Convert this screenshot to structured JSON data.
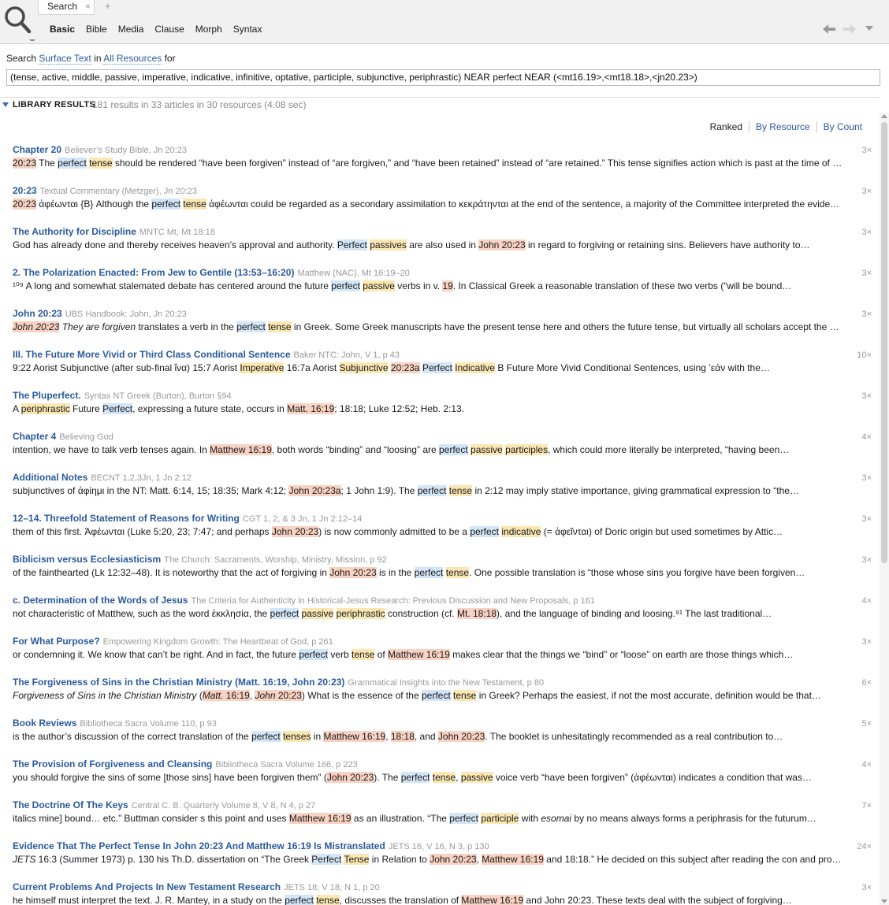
{
  "window": {
    "tab_label": "Search",
    "tab_close": "×",
    "tab_add": "+",
    "subtabs": [
      "Basic",
      "Bible",
      "Media",
      "Clause",
      "Morph",
      "Syntax"
    ],
    "active_subtab": "Basic"
  },
  "query": {
    "prefix": "Search",
    "field": "Surface Text",
    "in": "in",
    "scope": "All Resources",
    "for": "for",
    "text": "(tense, active, middle, passive, imperative, indicative, infinitive, optative, participle, subjunctive, periphrastic) NEAR perfect NEAR (<mt16.19>,<mt18.18>,<jn20.23>)"
  },
  "library": {
    "title": "LIBRARY RESULTS",
    "summary": "181 results in 33 articles in 30 resources (4.08 sec)"
  },
  "sort": [
    "Ranked",
    "By Resource",
    "By Count"
  ],
  "colors": {
    "link": "#2a5a9c",
    "hl_term": "#d3e6f7",
    "hl_form": "#fbe7b3",
    "hl_ref": "#f8d2c2"
  },
  "results": [
    {
      "title": "Chapter 20",
      "source": "Believer’s Study Bible, Jn 20:23",
      "count": "3×",
      "snippet": [
        [
          "o",
          "20:23"
        ],
        [
          "n",
          " The "
        ],
        [
          "b",
          "perfect"
        ],
        [
          "n",
          " "
        ],
        [
          "y",
          "tense"
        ],
        [
          "n",
          " should be rendered “have been forgiven” instead of “are forgiven,” and “have been retained” instead of “are retained.” This tense signifies action which is past at the time of speaking"
        ]
      ]
    },
    {
      "title": "20:23",
      "source": "Textual Commentary (Metzger), Jn 20:23",
      "count": "3×",
      "snippet": [
        [
          "o",
          "20:23"
        ],
        [
          "n",
          "    ἀφέωνται {B} Although the "
        ],
        [
          "b",
          "perfect"
        ],
        [
          "n",
          " "
        ],
        [
          "y",
          "tense"
        ],
        [
          "n",
          " ἀφέωνται could be regarded as a secondary assimilation to κεκράτηνται at the end of the sentence, a majority of the Committee interpreted the evidence"
        ]
      ]
    },
    {
      "title": "The Authority for Discipline",
      "source": "MNTC Mt, Mt 18:18",
      "count": "3×",
      "snippet": [
        [
          "n",
          "God has already done and thereby receives heaven’s approval and authority. "
        ],
        [
          "b",
          "Perfect"
        ],
        [
          "n",
          " "
        ],
        [
          "y",
          "passives"
        ],
        [
          "n",
          " are also used in "
        ],
        [
          "o",
          "John 20:23"
        ],
        [
          "n",
          " in regard to forgiving or retaining sins. Believers have authority to…"
        ]
      ]
    },
    {
      "title": "2. The Polarization Enacted: From Jew to Gentile (13:53–16:20)",
      "source": "Matthew (NAC), Mt 16:19–20",
      "count": "3×",
      "snippet": [
        [
          "n",
          "¹⁰⁹ A long and somewhat stalemated debate has centered around the future "
        ],
        [
          "b",
          "perfect"
        ],
        [
          "n",
          " "
        ],
        [
          "y",
          "passive"
        ],
        [
          "n",
          " verbs in v. "
        ],
        [
          "o",
          "19"
        ],
        [
          "n",
          ". In Classical Greek a reasonable translation of these two verbs (“will be bound…"
        ]
      ]
    },
    {
      "title": "John 20:23",
      "source": "UBS Handbook: John, Jn 20:23",
      "count": "3×",
      "snippet": [
        [
          "oi",
          "John 20:23"
        ],
        [
          "i",
          " They are forgiven"
        ],
        [
          "n",
          " translates a verb in the "
        ],
        [
          "b",
          "perfect"
        ],
        [
          "n",
          " "
        ],
        [
          "y",
          "tense"
        ],
        [
          "n",
          " in Greek. Some Greek manuscripts have the present tense here and others the future tense, but virtually all scholars accept the perfect"
        ]
      ]
    },
    {
      "title": "III. The Future More Vivid or Third Class Conditional Sentence",
      "source": "Baker NTC: John, V 1, p 43",
      "count": "10×",
      "snippet": [
        [
          "n",
          "9:22 Aorist Subjunctive (after sub-final ἵνα) 15:7 Aorist "
        ],
        [
          "y",
          "Imperative"
        ],
        [
          "n",
          " 16:7a Aorist "
        ],
        [
          "y",
          "Subjunctive"
        ],
        [
          "n",
          " "
        ],
        [
          "o",
          "20:23a"
        ],
        [
          "n",
          " "
        ],
        [
          "b",
          "Perfect"
        ],
        [
          "n",
          " "
        ],
        [
          "y",
          "Indicative"
        ],
        [
          "n",
          " B Future More Vivid Conditional Sentences, using ’εάν with the…"
        ]
      ]
    },
    {
      "title": "The Pluperfect.",
      "source": "Syntax NT Greek (Burton), Burton §94",
      "count": "3×",
      "snippet": [
        [
          "n",
          "A "
        ],
        [
          "y",
          "periphrastic"
        ],
        [
          "n",
          " Future "
        ],
        [
          "b",
          "Perfect"
        ],
        [
          "n",
          ", expressing a future state, occurs in "
        ],
        [
          "o",
          "Matt. 16:19"
        ],
        [
          "n",
          "; 18:18; Luke 12:52; Heb. 2:13."
        ]
      ]
    },
    {
      "title": "Chapter 4",
      "source": "Believing God",
      "count": "4×",
      "snippet": [
        [
          "n",
          "intention, we have to talk verb tenses again. In "
        ],
        [
          "o",
          "Matthew 16:19"
        ],
        [
          "n",
          ", both words “binding” and “loosing” are "
        ],
        [
          "b",
          "perfect"
        ],
        [
          "n",
          " "
        ],
        [
          "y",
          "passive"
        ],
        [
          "n",
          " "
        ],
        [
          "y",
          "participles"
        ],
        [
          "n",
          ", which could more literally be interpreted, “having been…"
        ]
      ]
    },
    {
      "title": "Additional Notes",
      "source": "BECNT 1,2,3Jn, 1 Jn 2:12",
      "count": "3×",
      "snippet": [
        [
          "n",
          "subjunctives of ἀφίημι in the NT: Matt. 6:14, 15; 18:35; Mark 4:12; "
        ],
        [
          "o",
          "John 20:23a"
        ],
        [
          "n",
          "; 1 John 1:9). The "
        ],
        [
          "b",
          "perfect"
        ],
        [
          "n",
          " "
        ],
        [
          "y",
          "tense"
        ],
        [
          "n",
          " in 2:12 may imply stative importance, giving grammatical expression to “the…"
        ]
      ]
    },
    {
      "title": "12–14. Threefold Statement of Reasons for Writing",
      "source": "CGT 1, 2, & 3 Jn, 1 Jn 2:12–14",
      "count": "3×",
      "snippet": [
        [
          "n",
          "them of this first. Ἀφέωνται (Luke 5:20, 23; 7:47; and perhaps "
        ],
        [
          "o",
          "John 20:23"
        ],
        [
          "n",
          ") is now commonly admitted to be a "
        ],
        [
          "b",
          "perfect"
        ],
        [
          "n",
          " "
        ],
        [
          "y",
          "indicative"
        ],
        [
          "n",
          " (= ἀφεῖνται) of Doric origin but used sometimes by Attic…"
        ]
      ]
    },
    {
      "title": "Biblicism versus Ecclesiasticism",
      "source": "The Church: Sacraments, Worship, Ministry, Mission, p 92",
      "count": "3×",
      "snippet": [
        [
          "n",
          "of the fainthearted (Lk 12:32–48). It is noteworthy that the act of forgiving in "
        ],
        [
          "o",
          "John 20:23"
        ],
        [
          "n",
          " is in the "
        ],
        [
          "b",
          "perfect"
        ],
        [
          "n",
          " "
        ],
        [
          "y",
          "tense"
        ],
        [
          "n",
          ". One possible translation is “those whose sins you forgive have been forgiven…"
        ]
      ]
    },
    {
      "title": "c. Determination of the Words of Jesus",
      "source": "The Criteria for Authenticity in Historical-Jesus Research: Previous Discussion and New Proposals, p 161",
      "count": "4×",
      "snippet": [
        [
          "n",
          "not characteristic of Matthew, such as the word ἐκκλησία, the "
        ],
        [
          "b",
          "perfect"
        ],
        [
          "n",
          " "
        ],
        [
          "y",
          "passive"
        ],
        [
          "n",
          " "
        ],
        [
          "y",
          "periphrastic"
        ],
        [
          "n",
          " construction (cf. "
        ],
        [
          "o",
          "Mt. 18:18"
        ],
        [
          "n",
          "), and the language of binding and loosing.⁹¹ The last traditional…"
        ]
      ]
    },
    {
      "title": "For What Purpose?",
      "source": "Empowering Kingdom Growth: The Heartbeat of God, p 261",
      "count": "3×",
      "snippet": [
        [
          "n",
          "or condemning it. We know that can’t be right. And in fact, the future "
        ],
        [
          "b",
          "perfect"
        ],
        [
          "n",
          " verb "
        ],
        [
          "y",
          "tense"
        ],
        [
          "n",
          " of "
        ],
        [
          "o",
          "Matthew 16:19"
        ],
        [
          "n",
          " makes clear that the things we “bind” or “loose” on earth are those things which…"
        ]
      ]
    },
    {
      "title": "The Forgiveness of Sins in the Christian Ministry (Matt. 16:19, John 20:23)",
      "source": "Grammatical Insights into the New Testament, p 80",
      "count": "6×",
      "snippet": [
        [
          "i",
          "Forgiveness of Sins in the Christian Ministry"
        ],
        [
          "n",
          " ("
        ],
        [
          "oi",
          "Matt."
        ],
        [
          "o",
          " 16:19"
        ],
        [
          "n",
          ", "
        ],
        [
          "oi",
          "John"
        ],
        [
          "o",
          " 20:23"
        ],
        [
          "n",
          ") What is the essence of the "
        ],
        [
          "b",
          "perfect"
        ],
        [
          "n",
          " "
        ],
        [
          "y",
          "tense"
        ],
        [
          "n",
          " in Greek? Perhaps the easiest, if not the most accurate, definition would be that…"
        ]
      ]
    },
    {
      "title": "Book Reviews",
      "source": "Bibliotheca Sacra Volume 110, p 93",
      "count": "5×",
      "snippet": [
        [
          "n",
          "is the author’s discussion of the correct translation of the "
        ],
        [
          "b",
          "perfect"
        ],
        [
          "n",
          " "
        ],
        [
          "y",
          "tenses"
        ],
        [
          "n",
          " in "
        ],
        [
          "o",
          "Matthew 16:19"
        ],
        [
          "n",
          ", "
        ],
        [
          "o",
          "18:18"
        ],
        [
          "n",
          ", and "
        ],
        [
          "o",
          "John 20:23"
        ],
        [
          "n",
          ". The booklet is unhesitatingly recommended as a real contribution to…"
        ]
      ]
    },
    {
      "title": "The Provision of Forgiveness and Cleansing",
      "source": "Bibliotheca Sacra Volume 166, p 223",
      "count": "4×",
      "snippet": [
        [
          "n",
          "you should forgive the sins of some [those sins] have been forgiven them” ("
        ],
        [
          "o",
          "John 20:23"
        ],
        [
          "n",
          "). The "
        ],
        [
          "b",
          "perfect"
        ],
        [
          "n",
          " "
        ],
        [
          "y",
          "tense"
        ],
        [
          "n",
          ", "
        ],
        [
          "y",
          "passive"
        ],
        [
          "n",
          " voice verb “have been forgiven” (ἀφέωνται) indicates a condition that was…"
        ]
      ]
    },
    {
      "title": "The Doctrine Of The Keys",
      "source": "Central C. B. Quarterly Volume 8, V 8, N 4, p 27",
      "count": "7×",
      "snippet": [
        [
          "n",
          "italics mine] bound… etc.” Buttman consider s this point and uses "
        ],
        [
          "o",
          "Matthew 16:19"
        ],
        [
          "n",
          " as an illustration. “The "
        ],
        [
          "b",
          "perfect"
        ],
        [
          "n",
          " "
        ],
        [
          "y",
          "participle"
        ],
        [
          "n",
          " with "
        ],
        [
          "i",
          "esomai"
        ],
        [
          "n",
          " by no means always forms a periphrasis for the futurum…"
        ]
      ]
    },
    {
      "title": "Evidence That The Perfect Tense In John 20:23 And Matthew 16:19 Is Mistranslated",
      "source": "JETS 16, V 16, N 3, p 130",
      "count": "24×",
      "snippet": [
        [
          "i",
          "JETS"
        ],
        [
          "n",
          " 16:3 (Summer 1973) p. 130 his Th.D. dissertation on “The Greek "
        ],
        [
          "b",
          "Perfect"
        ],
        [
          "n",
          " "
        ],
        [
          "y",
          "Tense"
        ],
        [
          "n",
          " in Relation to "
        ],
        [
          "o",
          "John 20:23"
        ],
        [
          "n",
          ", "
        ],
        [
          "o",
          "Matthew 16:19"
        ],
        [
          "n",
          " and 18:18.” He decided on this subject after reading the con and pro…"
        ]
      ]
    },
    {
      "title": "Current Problems And Projects  In New Testament Research",
      "source": "JETS 18, V 18, N 1, p 20",
      "count": "3×",
      "snippet": [
        [
          "n",
          "he himself must interpret the text. J. R. Mantey, in a study on the "
        ],
        [
          "b",
          "perfect"
        ],
        [
          "n",
          " "
        ],
        [
          "y",
          "tense"
        ],
        [
          "n",
          ", discusses the translation of "
        ],
        [
          "o",
          "Matthew 16:19"
        ],
        [
          "n",
          " and John 20:23. These texts deal with the subject of forgiving…"
        ]
      ]
    }
  ]
}
